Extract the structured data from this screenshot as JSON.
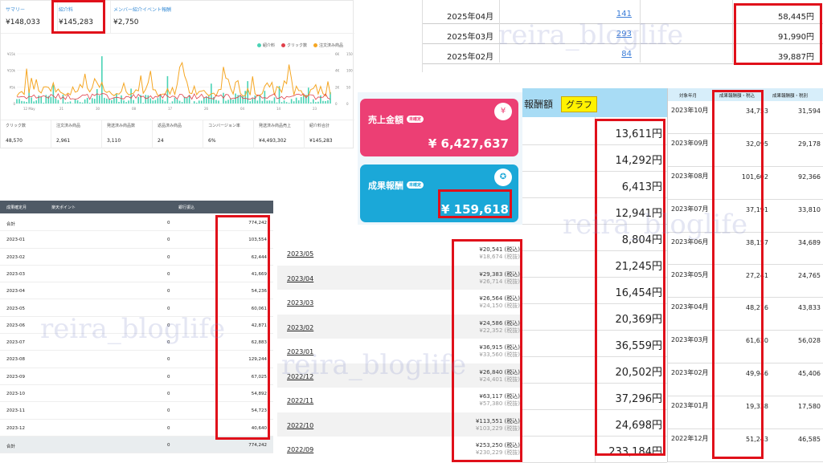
{
  "summary_panel": {
    "tabs": [
      {
        "label": "サマリー",
        "value": "¥148,033"
      },
      {
        "label": "紹介料",
        "value": "¥145,283"
      },
      {
        "label": "メンバー紹介イベント報酬",
        "value": "¥2,750"
      }
    ],
    "legend": [
      {
        "label": "紹介料",
        "color": "#4ad3b5"
      },
      {
        "label": "クリック数",
        "color": "#e0404a"
      },
      {
        "label": "注文済み商品",
        "color": "#f5a623"
      }
    ],
    "y_left_ticks": [
      "¥15k",
      "¥10k",
      "¥5k",
      "0"
    ],
    "y_right_ticks_a": [
      "6K",
      "4K",
      "2K",
      "0"
    ],
    "y_right_ticks_b": [
      "150",
      "100",
      "50",
      "0"
    ],
    "x_ticks": [
      "12 May",
      "21",
      "30",
      "08",
      "17",
      "26",
      "04",
      "14",
      "23"
    ],
    "footer": [
      {
        "label": "クリック数",
        "value": "48,570"
      },
      {
        "label": "注文済み商品",
        "value": "2,961"
      },
      {
        "label": "発送済み商品数",
        "value": "3,110"
      },
      {
        "label": "返品済み商品",
        "value": "24"
      },
      {
        "label": "コンバージョン率",
        "value": "6%"
      },
      {
        "label": "発送済み商品売上",
        "value": "¥4,493,302"
      },
      {
        "label": "紹介料合計",
        "value": "¥145,283"
      }
    ]
  },
  "monthly_rows": [
    {
      "date": "2025年04月",
      "count": "141",
      "amount": "58,445円"
    },
    {
      "date": "2025年03月",
      "count": "293",
      "amount": "91,990円"
    },
    {
      "date": "2025年02月",
      "count": "84",
      "amount": "39,887円"
    }
  ],
  "cards": {
    "sales": {
      "title": "売上金額",
      "badge": "未確定",
      "amount": "¥ 6,427,637",
      "icon": "yen-icon",
      "color": "#ec3f74"
    },
    "reward": {
      "title": "成果報酬",
      "badge": "未確定",
      "amount": "¥ 159,618",
      "icon": "medal-icon",
      "color": "#1ba8d8"
    }
  },
  "rakuten": {
    "headers": [
      "成果確定月",
      "楽天ポイント",
      "銀行振込"
    ],
    "rows": [
      [
        "合計",
        "0",
        "774,242"
      ],
      [
        "2023-01",
        "0",
        "103,554"
      ],
      [
        "2023-02",
        "0",
        "62,444"
      ],
      [
        "2023-03",
        "0",
        "41,669"
      ],
      [
        "2023-04",
        "0",
        "54,236"
      ],
      [
        "2023-05",
        "0",
        "60,061"
      ],
      [
        "2023-06",
        "0",
        "42,871"
      ],
      [
        "2023-07",
        "0",
        "62,883"
      ],
      [
        "2023-08",
        "0",
        "129,244"
      ],
      [
        "2023-09",
        "0",
        "67,025"
      ],
      [
        "2023-10",
        "0",
        "54,892"
      ],
      [
        "2023-11",
        "0",
        "54,723"
      ],
      [
        "2023-12",
        "0",
        "40,640"
      ],
      [
        "合計",
        "0",
        "774,242"
      ]
    ]
  },
  "month_list": [
    {
      "date": "2023/05",
      "incl": "¥20,541 (税込)",
      "excl": "¥18,674 (税抜)"
    },
    {
      "date": "2023/04",
      "incl": "¥29,383 (税込)",
      "excl": "¥26,714 (税抜)"
    },
    {
      "date": "2023/03",
      "incl": "¥26,564 (税込)",
      "excl": "¥24,150 (税抜)"
    },
    {
      "date": "2023/02",
      "incl": "¥24,586 (税込)",
      "excl": "¥22,352 (税抜)"
    },
    {
      "date": "2023/01",
      "incl": "¥36,915 (税込)",
      "excl": "¥33,560 (税抜)"
    },
    {
      "date": "2022/12",
      "incl": "¥26,840 (税込)",
      "excl": "¥24,401 (税抜)"
    },
    {
      "date": "2022/11",
      "incl": "¥63,117 (税込)",
      "excl": "¥57,380 (税抜)"
    },
    {
      "date": "2022/10",
      "incl": "¥113,551 (税込)",
      "excl": "¥103,229 (税抜)"
    },
    {
      "date": "2022/09",
      "incl": "¥253,250 (税込)",
      "excl": "¥230,229 (税抜)"
    }
  ],
  "reward_column": {
    "header": "報酬額",
    "graph_button": "グラフ",
    "values": [
      "13,611円",
      "14,292円",
      "6,413円",
      "12,941円",
      "8,804円",
      "21,245円",
      "16,454円",
      "20,369円",
      "36,559円",
      "20,502円",
      "37,296円",
      "24,698円",
      "233,184円"
    ]
  },
  "right_table": {
    "headers": [
      "対象年月",
      "成果報酬額・税込",
      "成果報酬額・税別"
    ],
    "rows": [
      [
        "2023年10月",
        "34,753",
        "31,594"
      ],
      [
        "2023年09月",
        "32,095",
        "29,178"
      ],
      [
        "2023年08月",
        "101,602",
        "92,366"
      ],
      [
        "2023年07月",
        "37,191",
        "33,810"
      ],
      [
        "2023年06月",
        "38,157",
        "34,689"
      ],
      [
        "2023年05月",
        "27,241",
        "24,765"
      ],
      [
        "2023年04月",
        "48,216",
        "43,833"
      ],
      [
        "2023年03月",
        "61,630",
        "56,028"
      ],
      [
        "2023年02月",
        "49,946",
        "45,406"
      ],
      [
        "2023年01月",
        "19,338",
        "17,580"
      ],
      [
        "2022年12月",
        "51,243",
        "46,585"
      ]
    ]
  },
  "watermark": "reira_bloglife"
}
